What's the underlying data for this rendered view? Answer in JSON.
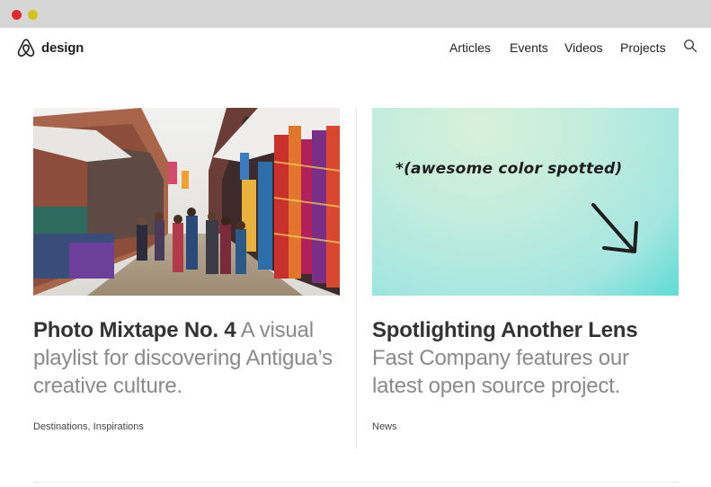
{
  "window": {
    "controls": [
      "close",
      "minimize"
    ]
  },
  "header": {
    "brand": "design",
    "logo_icon": "airbnb-belo-icon",
    "nav": [
      {
        "label": "Articles"
      },
      {
        "label": "Events"
      },
      {
        "label": "Videos"
      },
      {
        "label": "Projects"
      }
    ],
    "search_icon": "search-icon"
  },
  "articles": [
    {
      "title": "Photo Mixtape No. 4",
      "description": "A visual playlist for discovering Antigua’s creative culture.",
      "tags": "Destinations, Inspirations",
      "image": "market street photo"
    },
    {
      "title": "Spotlighting Another Lens",
      "description": "Fast Company features our latest open source project.",
      "tags": "News",
      "image_annotation": "*(awesome color spotted)",
      "arrow_icon": "hand-drawn-arrow-icon"
    }
  ]
}
